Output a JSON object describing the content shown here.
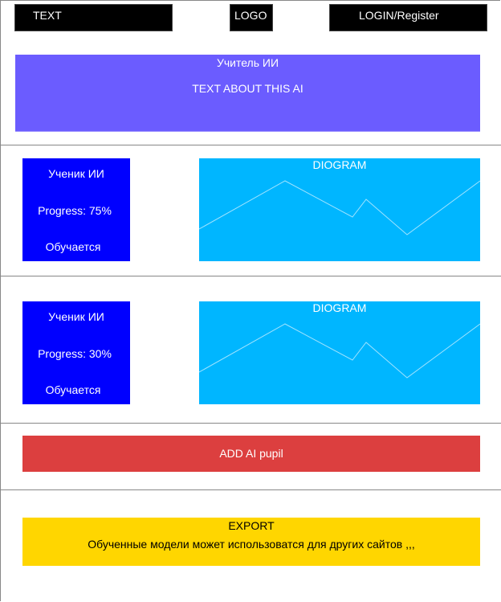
{
  "header": {
    "text": "TEXT",
    "logo": "LOGO",
    "login": "LOGIN/Register"
  },
  "teacher": {
    "title": "Учитель ИИ",
    "description": "TEXT ABOUT THIS AI"
  },
  "pupils": [
    {
      "title": "Ученик ИИ",
      "progress": "Progress: 75%",
      "status": "Обучается",
      "diagram_title": "DIOGRAM"
    },
    {
      "title": "Ученик ИИ",
      "progress": "Progress: 30%",
      "status": "Обучается",
      "diagram_title": "DIOGRAM"
    }
  ],
  "add_button": "ADD AI pupil",
  "export": {
    "title": "EXPORT",
    "description": "Обученные модели может использоватся для других сайтов ,,,"
  }
}
